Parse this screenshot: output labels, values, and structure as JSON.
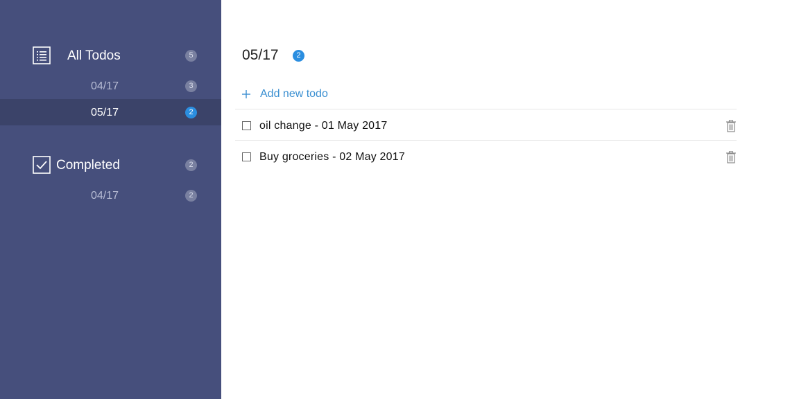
{
  "sidebar": {
    "all_todos": {
      "label": "All Todos",
      "count": "5",
      "icon": "list-icon",
      "items": [
        {
          "label": "04/17",
          "count": "3",
          "selected": false
        },
        {
          "label": "05/17",
          "count": "2",
          "selected": true
        }
      ]
    },
    "completed": {
      "label": "Completed",
      "count": "2",
      "icon": "checkbox-checked-icon",
      "items": [
        {
          "label": "04/17",
          "count": "2",
          "selected": false
        }
      ]
    }
  },
  "main": {
    "title": "05/17",
    "count": "2",
    "add_label": "Add new todo",
    "todos": [
      {
        "text": "oil change - 01 May 2017",
        "done": false
      },
      {
        "text": "Buy groceries - 02 May 2017",
        "done": false
      }
    ]
  },
  "colors": {
    "sidebar_bg": "#464f7c",
    "sidebar_selected_bg": "#3b4369",
    "accent": "#2b8ee0",
    "link": "#3a8fd1"
  }
}
